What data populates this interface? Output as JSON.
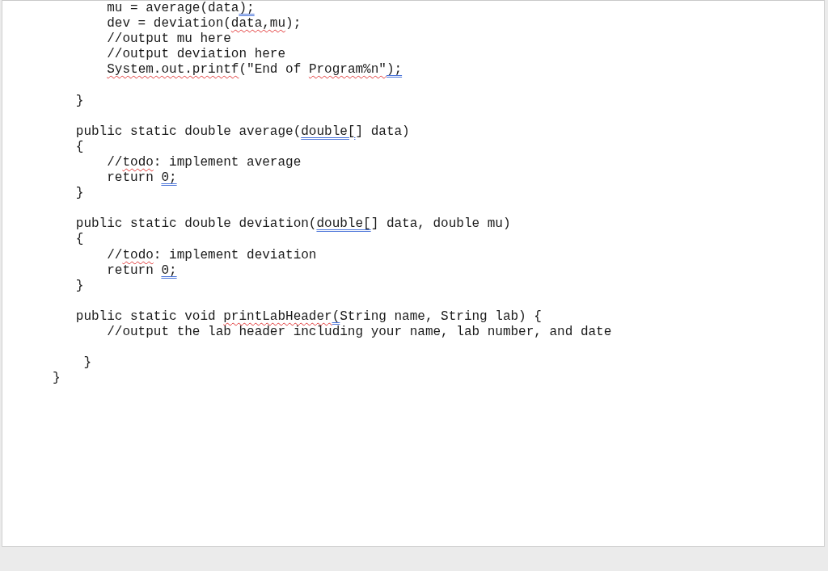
{
  "document": {
    "lines": [
      {
        "kind": "code",
        "segments": [
          {
            "text": "       mu = average(data"
          },
          {
            "text": ");",
            "grammar_error": true
          }
        ]
      },
      {
        "kind": "code",
        "segments": [
          {
            "text": "       dev = deviation("
          },
          {
            "text": "data,mu",
            "spelling_error": true
          },
          {
            "text": ");"
          }
        ]
      },
      {
        "kind": "code",
        "segments": [
          {
            "text": "       //output mu here"
          }
        ]
      },
      {
        "kind": "code",
        "segments": [
          {
            "text": "       //output deviation here"
          }
        ]
      },
      {
        "kind": "code",
        "segments": [
          {
            "text": "       System.out.printf",
            "spelling_error": true
          },
          {
            "text": "(\"End of "
          },
          {
            "text": "Program%n\"",
            "spelling_error": true
          },
          {
            "text": ");",
            "grammar_error": true
          }
        ]
      },
      {
        "kind": "blank"
      },
      {
        "kind": "code",
        "segments": [
          {
            "text": "   }"
          }
        ]
      },
      {
        "kind": "blank"
      },
      {
        "kind": "code",
        "segments": [
          {
            "text": "   public static double average("
          },
          {
            "text": "double[",
            "grammar_error": true
          },
          {
            "text": "] data)"
          }
        ]
      },
      {
        "kind": "code",
        "segments": [
          {
            "text": "   {"
          }
        ]
      },
      {
        "kind": "code",
        "segments": [
          {
            "text": "       //"
          },
          {
            "text": "todo",
            "spelling_error": true
          },
          {
            "text": ": implement average"
          }
        ]
      },
      {
        "kind": "code",
        "segments": [
          {
            "text": "       return "
          },
          {
            "text": "0;",
            "grammar_error": true
          }
        ]
      },
      {
        "kind": "code",
        "segments": [
          {
            "text": "   }"
          }
        ]
      },
      {
        "kind": "blank"
      },
      {
        "kind": "code",
        "segments": [
          {
            "text": "   public static double deviation("
          },
          {
            "text": "double[",
            "grammar_error": true
          },
          {
            "text": "] data, double mu)"
          }
        ]
      },
      {
        "kind": "code",
        "segments": [
          {
            "text": "   {"
          }
        ]
      },
      {
        "kind": "code",
        "segments": [
          {
            "text": "       //"
          },
          {
            "text": "todo",
            "spelling_error": true
          },
          {
            "text": ": implement deviation"
          }
        ]
      },
      {
        "kind": "code",
        "segments": [
          {
            "text": "       return "
          },
          {
            "text": "0;",
            "grammar_error": true
          }
        ]
      },
      {
        "kind": "code",
        "segments": [
          {
            "text": "   }"
          }
        ]
      },
      {
        "kind": "blank"
      },
      {
        "kind": "code",
        "segments": [
          {
            "text": "   public static void "
          },
          {
            "text": "printLabHeader",
            "spelling_error": true
          },
          {
            "text": "(",
            "grammar_error": true
          },
          {
            "text": "String name, String lab) {"
          }
        ]
      },
      {
        "kind": "code",
        "segments": [
          {
            "text": "       //output the lab header including your name, lab number, and date"
          }
        ]
      },
      {
        "kind": "blank"
      },
      {
        "kind": "code",
        "segments": [
          {
            "text": "    }"
          }
        ]
      },
      {
        "kind": "code",
        "segments": [
          {
            "text": "}"
          }
        ]
      }
    ]
  }
}
